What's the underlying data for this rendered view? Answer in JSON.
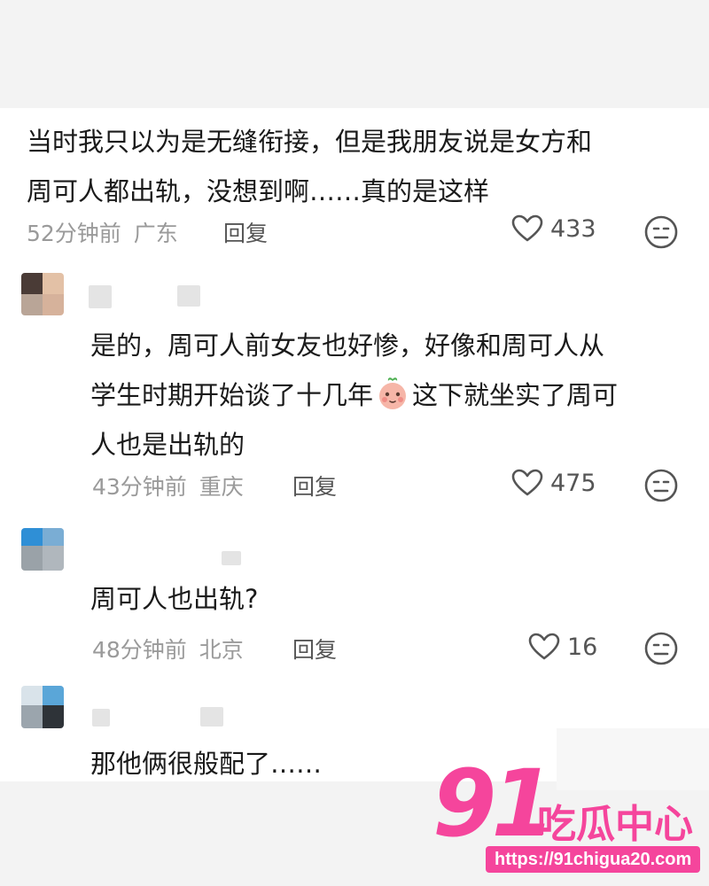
{
  "comments": [
    {
      "lines": [
        "当时我只以为是无缝衔接，但是我朋友说是女方和",
        "周可人都出轨，没想到啊……真的是这样"
      ],
      "time": "52分钟前",
      "location": "广东",
      "reply_label": "回复",
      "likes": "433"
    },
    {
      "lines": [
        "是的，周可人前女友也好惨，好像和周可人从",
        "学生时期开始谈了十几年",
        "这下就坐实了周可",
        "人也是出轨的"
      ],
      "time": "43分钟前",
      "location": "重庆",
      "reply_label": "回复",
      "likes": "475"
    },
    {
      "lines": [
        "周可人也出轨?"
      ],
      "time": "48分钟前",
      "location": "北京",
      "reply_label": "回复",
      "likes": "16"
    },
    {
      "lines": [
        "那他俩很般配了……"
      ]
    }
  ],
  "watermark": {
    "number": "91",
    "text": "吃瓜中心",
    "url": "https://91chigua20.com"
  },
  "icons": {
    "like": "heart-outline-icon",
    "dislike": "neutral-face-icon",
    "inline_emoji": "baby-face-emoji"
  },
  "colors": {
    "watermark": "#f5459c",
    "meta_text": "#9a9a9a"
  }
}
